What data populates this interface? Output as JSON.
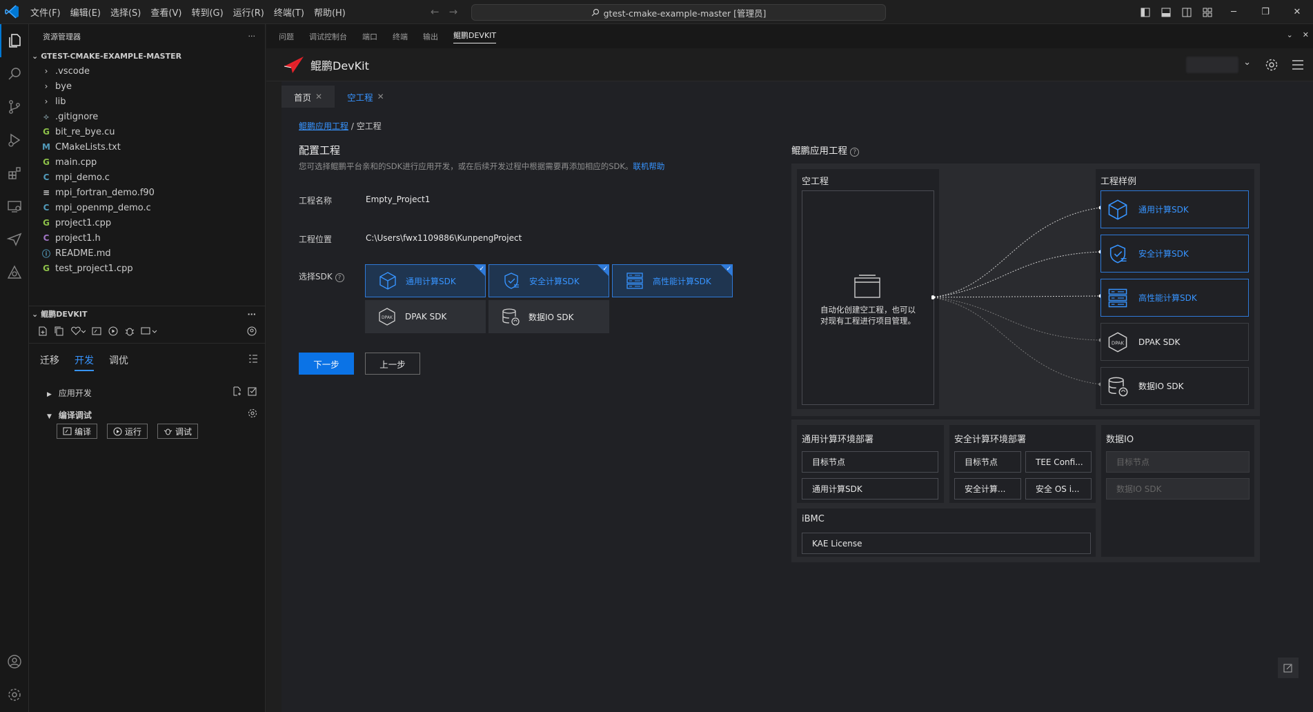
{
  "menu": [
    "文件(F)",
    "编辑(E)",
    "选择(S)",
    "查看(V)",
    "转到(G)",
    "运行(R)",
    "终端(T)",
    "帮助(H)"
  ],
  "command_center": "gtest-cmake-example-master [管理员]",
  "sidebar": {
    "title": "资源管理器",
    "folder": "GTEST-CMAKE-EXAMPLE-MASTER",
    "folders": [
      ".vscode",
      "bye",
      "lib"
    ],
    "files": [
      {
        "icon": "⟡",
        "color": "#6d8086",
        "name": ".gitignore"
      },
      {
        "icon": "G",
        "color": "#8dc149",
        "name": "bit_re_bye.cu"
      },
      {
        "icon": "M",
        "color": "#519aba",
        "name": "CMakeLists.txt"
      },
      {
        "icon": "G",
        "color": "#8dc149",
        "name": "main.cpp"
      },
      {
        "icon": "C",
        "color": "#519aba",
        "name": "mpi_demo.c"
      },
      {
        "icon": "≡",
        "color": "#cccccc",
        "name": "mpi_fortran_demo.f90"
      },
      {
        "icon": "C",
        "color": "#519aba",
        "name": "mpi_openmp_demo.c"
      },
      {
        "icon": "G",
        "color": "#8dc149",
        "name": "project1.cpp"
      },
      {
        "icon": "C",
        "color": "#a074c4",
        "name": "project1.h"
      },
      {
        "icon": "ⓘ",
        "color": "#519aba",
        "name": "README.md"
      },
      {
        "icon": "G",
        "color": "#8dc149",
        "name": "test_project1.cpp"
      }
    ],
    "devkit_section": "鲲鹏DEVKIT",
    "devkit_tabs": [
      "迁移",
      "开发",
      "调优"
    ],
    "tree": {
      "app_dev": "应用开发",
      "build_debug": "编译调试"
    },
    "actions": {
      "compile": "编译",
      "run": "运行",
      "debug": "调试"
    }
  },
  "panel_tabs": [
    "问题",
    "调试控制台",
    "端口",
    "终端",
    "输出",
    "鲲鹏DEVKIT"
  ],
  "devkit": {
    "brand": "鲲鹏DevKit",
    "page_tabs": [
      "首页",
      "空工程"
    ],
    "breadcrumb": {
      "link": "鲲鹏应用工程",
      "sep": " / ",
      "current": "空工程"
    },
    "config_title": "配置工程",
    "config_desc": "您可选择鲲鹏平台亲和的SDK进行应用开发，或在后续开发过程中根据需要再添加相应的SDK。",
    "help_link": "联机帮助",
    "name_label": "工程名称",
    "name_value": "Empty_Project1",
    "location_label": "工程位置",
    "location_value": "C:\\Users\\fwx1109886\\KunpengProject",
    "sdk_label": "选择SDK",
    "sdks": [
      {
        "name": "通用计算SDK",
        "selected": true
      },
      {
        "name": "安全计算SDK",
        "selected": true
      },
      {
        "name": "高性能计算SDK",
        "selected": true
      },
      {
        "name": "DPAK SDK",
        "selected": false
      },
      {
        "name": "数据IO SDK",
        "selected": false
      }
    ],
    "next_btn": "下一步",
    "prev_btn": "上一步"
  },
  "diagram": {
    "title": "鲲鹏应用工程",
    "empty_title": "空工程",
    "empty_desc_1": "自动化创建空工程，也可以",
    "empty_desc_2": "对现有工程进行项目管理。",
    "samples_title": "工程样例",
    "samples": [
      {
        "name": "通用计算SDK",
        "selected": true
      },
      {
        "name": "安全计算SDK",
        "selected": true
      },
      {
        "name": "高性能计算SDK",
        "selected": true
      },
      {
        "name": "DPAK SDK",
        "selected": false
      },
      {
        "name": "数据IO SDK",
        "selected": false
      }
    ],
    "env": {
      "general_title": "通用计算环境部署",
      "general_items": [
        "目标节点",
        "通用计算SDK"
      ],
      "secure_title": "安全计算环境部署",
      "secure_items": [
        "目标节点",
        "TEE Confi...",
        "安全计算...",
        "安全 OS i..."
      ],
      "dataio_title": "数据IO",
      "dataio_items": [
        "目标节点",
        "数据IO SDK"
      ],
      "ibmc_title": "iBMC",
      "ibmc_items": [
        "KAE License"
      ]
    }
  },
  "colors": {
    "accent": "#3794ff",
    "primary": "#0b73e6"
  }
}
